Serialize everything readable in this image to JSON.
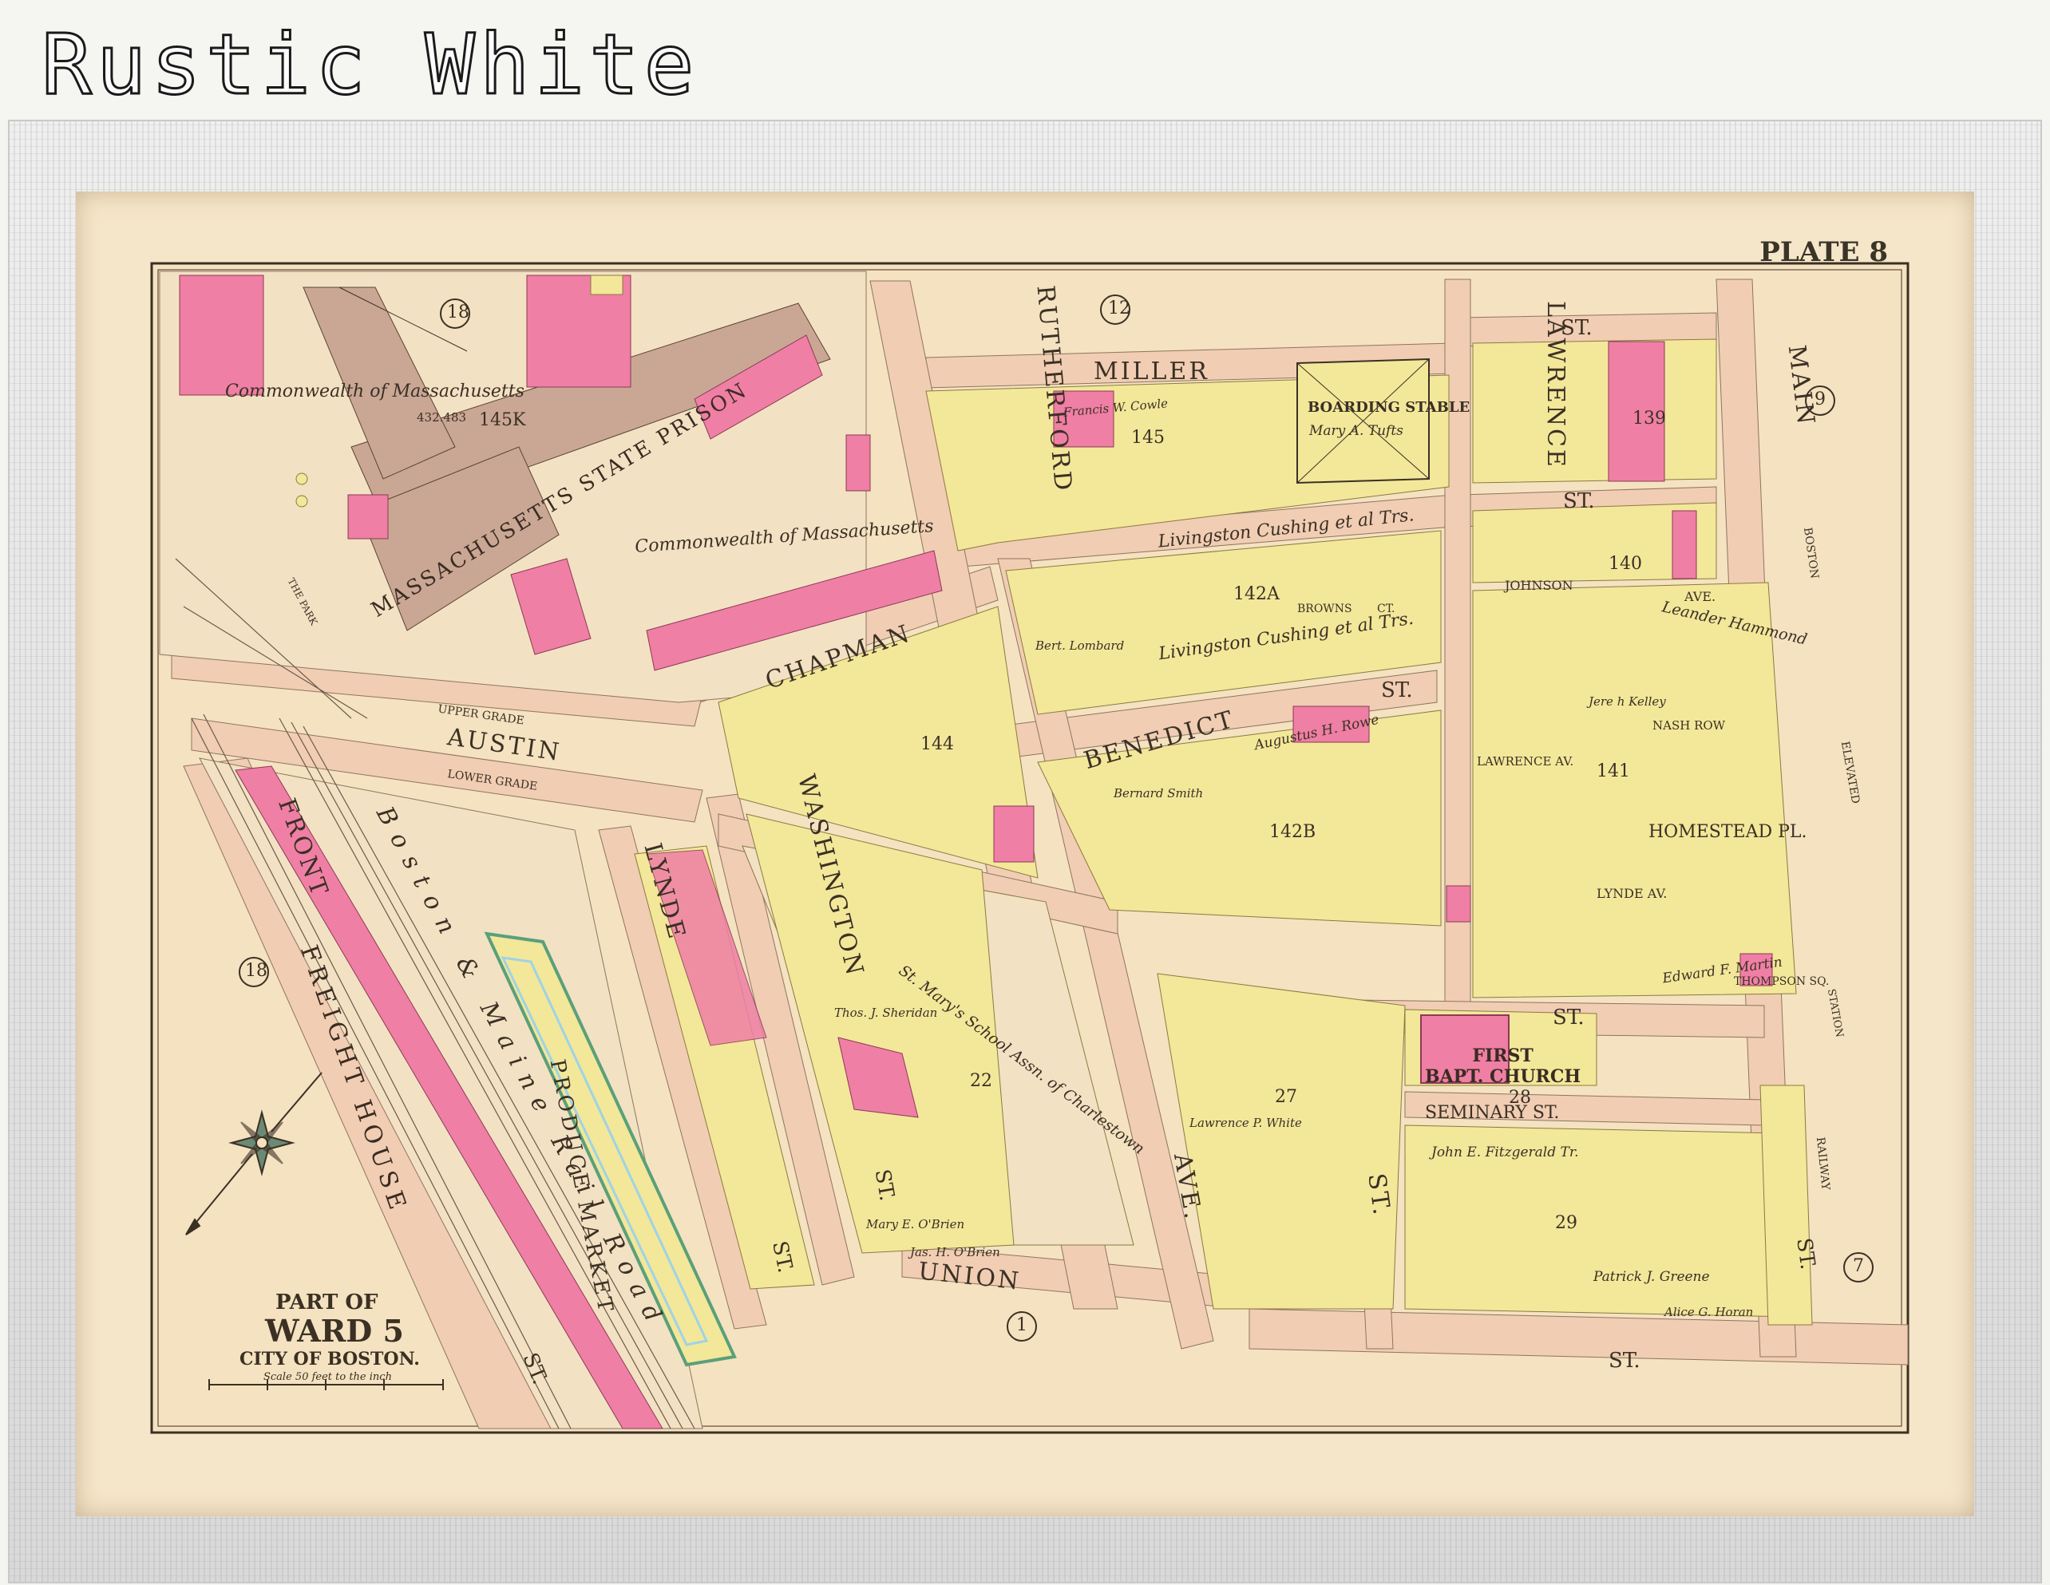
{
  "banner": {
    "title": "Rustic White"
  },
  "plate": {
    "label": "PLATE 8"
  },
  "title_block": {
    "line1": "PART OF",
    "line2": "WARD 5",
    "line3": "CITY OF BOSTON.",
    "scale": "Scale 50 feet to the inch"
  },
  "streets": {
    "miller": "MILLER",
    "st": "ST.",
    "chapman": "CHAPMAN",
    "benedict": "BENEDICT",
    "austin": "AUSTIN",
    "upper_grade": "UPPER GRADE",
    "lower_grade": "LOWER GRADE",
    "rutherford": "RUTHERFORD",
    "lawrence": "LAWRENCE",
    "main": "MAIN",
    "washington": "WASHINGTON",
    "lynde": "LYNDE",
    "front": "FRONT",
    "union": "UNION",
    "ave": "AVE.",
    "johnson": "JOHNSON",
    "ave_short": "AVE.",
    "browns": "BROWNS",
    "ct": "CT.",
    "nash_row": "NASH ROW",
    "lawrence_av": "LAWRENCE AV.",
    "homestead": "HOMESTEAD PL.",
    "lynde_av": "LYNDE AV.",
    "seminary": "SEMINARY ST.",
    "thompson": "THOMPSON SQ.",
    "elevated": "ELEVATED",
    "station": "STATION",
    "railway": "RAILWAY",
    "boston": "BOSTON"
  },
  "wards": {
    "n18a": "18",
    "n18b": "18",
    "n12": "12",
    "n9": "9",
    "n7": "7",
    "n1": "1"
  },
  "blocks": {
    "b145": "145",
    "b139": "139",
    "b140": "140",
    "b142a": "142A",
    "b142b": "142B",
    "b144": "144",
    "b141": "141",
    "b145k": "145K",
    "b28": "28",
    "b27": "27",
    "b29": "29",
    "b22": "22"
  },
  "labels": {
    "commonwealth1": "Commonwealth of Massachusetts",
    "commonwealth2": "Commonwealth of Massachusetts",
    "prison": "MASSACHUSETTS STATE PRISON",
    "prison_area": "432.483",
    "the_park": "THE PARK",
    "freight": "FREIGHT HOUSE",
    "produce": "PRODUCE MARKET",
    "bm_railroad": "Boston & Maine Rail Road",
    "boarding": "BOARDING STABLE",
    "boarding_owner": "Mary A. Tufts",
    "baptist1": "FIRST",
    "baptist2": "BAPT. CHURCH",
    "livingston1": "Livingston Cushing et al Trs.",
    "livingston2": "Livingston Cushing et al Trs.",
    "st_marys": "St. Mary's School Assn. of Charlestown",
    "leander": "Leander Hammond",
    "augustus": "Augustus H. Rowe",
    "francis": "Francis W. Cowle",
    "jeremiah": "Jere h Kelley",
    "edward": "Edward F. Martin",
    "patrick": "Patrick J. Greene",
    "alice": "Alice G. Horan",
    "john_fitz": "John E. Fitzgerald Tr.",
    "lawrence_white": "Lawrence P. White",
    "jas_obrien": "Jas. H. O'Brien",
    "mary_obrien": "Mary E. O'Brien",
    "bernard": "Bernard Smith",
    "thos_sheridan": "Thos. J. Sheridan",
    "bert_lombard": "Bert. Lombard"
  },
  "colors": {
    "paper": "#f3e0bd",
    "yellow": "#f3e79a",
    "pink": "#ef7fa4",
    "tan": "#c9a794",
    "street": "#f0cdb3",
    "green": "#b9e3c6",
    "blue": "#9ed3e6",
    "ink": "#3b3024"
  }
}
